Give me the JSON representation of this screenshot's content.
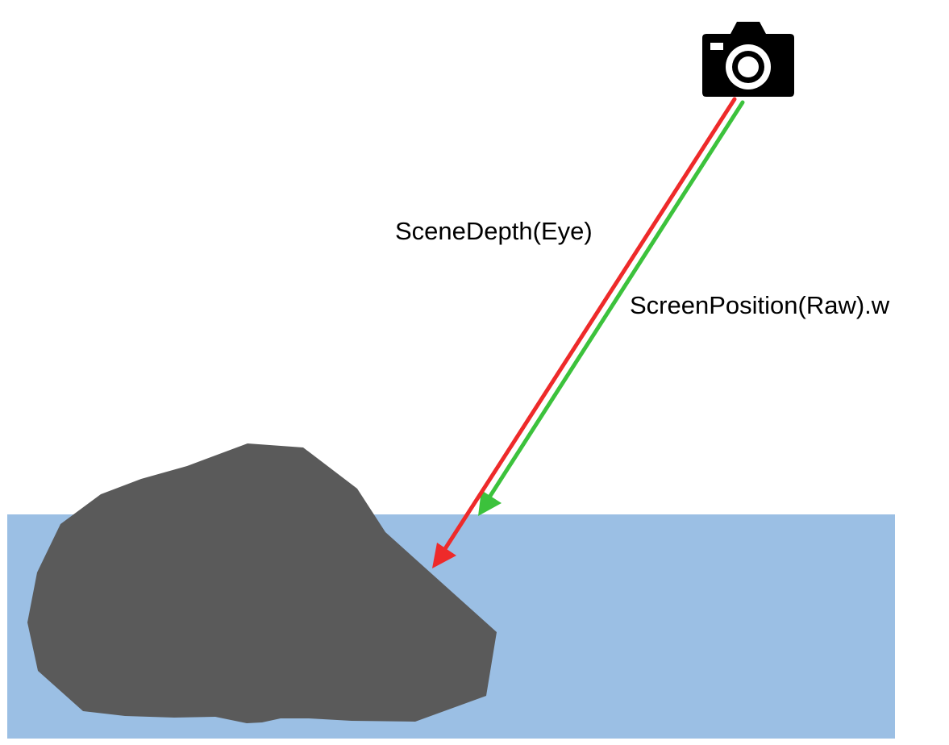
{
  "labels": {
    "scene_depth": "SceneDepth(Eye)",
    "screen_position": "ScreenPosition(Raw).w"
  },
  "colors": {
    "water": "#9bbfe4",
    "rock": "#5a5a5a",
    "scene_depth_arrow": "#ee2a2a",
    "screen_position_arrow": "#3cc23c",
    "camera": "#000000"
  },
  "icons": {
    "camera": "camera-icon"
  }
}
